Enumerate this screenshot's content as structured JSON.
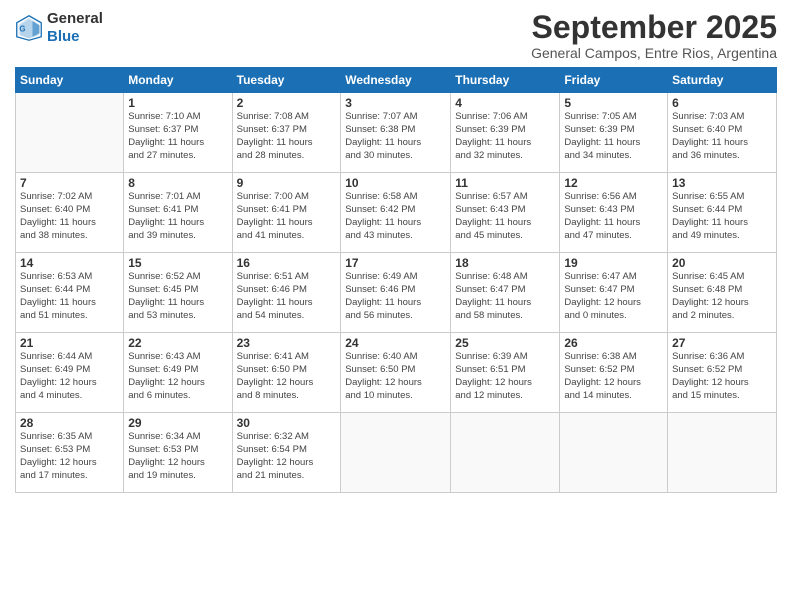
{
  "header": {
    "logo_general": "General",
    "logo_blue": "Blue",
    "title": "September 2025",
    "subtitle": "General Campos, Entre Rios, Argentina"
  },
  "days_of_week": [
    "Sunday",
    "Monday",
    "Tuesday",
    "Wednesday",
    "Thursday",
    "Friday",
    "Saturday"
  ],
  "weeks": [
    [
      {
        "day": "",
        "info": ""
      },
      {
        "day": "1",
        "info": "Sunrise: 7:10 AM\nSunset: 6:37 PM\nDaylight: 11 hours\nand 27 minutes."
      },
      {
        "day": "2",
        "info": "Sunrise: 7:08 AM\nSunset: 6:37 PM\nDaylight: 11 hours\nand 28 minutes."
      },
      {
        "day": "3",
        "info": "Sunrise: 7:07 AM\nSunset: 6:38 PM\nDaylight: 11 hours\nand 30 minutes."
      },
      {
        "day": "4",
        "info": "Sunrise: 7:06 AM\nSunset: 6:39 PM\nDaylight: 11 hours\nand 32 minutes."
      },
      {
        "day": "5",
        "info": "Sunrise: 7:05 AM\nSunset: 6:39 PM\nDaylight: 11 hours\nand 34 minutes."
      },
      {
        "day": "6",
        "info": "Sunrise: 7:03 AM\nSunset: 6:40 PM\nDaylight: 11 hours\nand 36 minutes."
      }
    ],
    [
      {
        "day": "7",
        "info": "Sunrise: 7:02 AM\nSunset: 6:40 PM\nDaylight: 11 hours\nand 38 minutes."
      },
      {
        "day": "8",
        "info": "Sunrise: 7:01 AM\nSunset: 6:41 PM\nDaylight: 11 hours\nand 39 minutes."
      },
      {
        "day": "9",
        "info": "Sunrise: 7:00 AM\nSunset: 6:41 PM\nDaylight: 11 hours\nand 41 minutes."
      },
      {
        "day": "10",
        "info": "Sunrise: 6:58 AM\nSunset: 6:42 PM\nDaylight: 11 hours\nand 43 minutes."
      },
      {
        "day": "11",
        "info": "Sunrise: 6:57 AM\nSunset: 6:43 PM\nDaylight: 11 hours\nand 45 minutes."
      },
      {
        "day": "12",
        "info": "Sunrise: 6:56 AM\nSunset: 6:43 PM\nDaylight: 11 hours\nand 47 minutes."
      },
      {
        "day": "13",
        "info": "Sunrise: 6:55 AM\nSunset: 6:44 PM\nDaylight: 11 hours\nand 49 minutes."
      }
    ],
    [
      {
        "day": "14",
        "info": "Sunrise: 6:53 AM\nSunset: 6:44 PM\nDaylight: 11 hours\nand 51 minutes."
      },
      {
        "day": "15",
        "info": "Sunrise: 6:52 AM\nSunset: 6:45 PM\nDaylight: 11 hours\nand 53 minutes."
      },
      {
        "day": "16",
        "info": "Sunrise: 6:51 AM\nSunset: 6:46 PM\nDaylight: 11 hours\nand 54 minutes."
      },
      {
        "day": "17",
        "info": "Sunrise: 6:49 AM\nSunset: 6:46 PM\nDaylight: 11 hours\nand 56 minutes."
      },
      {
        "day": "18",
        "info": "Sunrise: 6:48 AM\nSunset: 6:47 PM\nDaylight: 11 hours\nand 58 minutes."
      },
      {
        "day": "19",
        "info": "Sunrise: 6:47 AM\nSunset: 6:47 PM\nDaylight: 12 hours\nand 0 minutes."
      },
      {
        "day": "20",
        "info": "Sunrise: 6:45 AM\nSunset: 6:48 PM\nDaylight: 12 hours\nand 2 minutes."
      }
    ],
    [
      {
        "day": "21",
        "info": "Sunrise: 6:44 AM\nSunset: 6:49 PM\nDaylight: 12 hours\nand 4 minutes."
      },
      {
        "day": "22",
        "info": "Sunrise: 6:43 AM\nSunset: 6:49 PM\nDaylight: 12 hours\nand 6 minutes."
      },
      {
        "day": "23",
        "info": "Sunrise: 6:41 AM\nSunset: 6:50 PM\nDaylight: 12 hours\nand 8 minutes."
      },
      {
        "day": "24",
        "info": "Sunrise: 6:40 AM\nSunset: 6:50 PM\nDaylight: 12 hours\nand 10 minutes."
      },
      {
        "day": "25",
        "info": "Sunrise: 6:39 AM\nSunset: 6:51 PM\nDaylight: 12 hours\nand 12 minutes."
      },
      {
        "day": "26",
        "info": "Sunrise: 6:38 AM\nSunset: 6:52 PM\nDaylight: 12 hours\nand 14 minutes."
      },
      {
        "day": "27",
        "info": "Sunrise: 6:36 AM\nSunset: 6:52 PM\nDaylight: 12 hours\nand 15 minutes."
      }
    ],
    [
      {
        "day": "28",
        "info": "Sunrise: 6:35 AM\nSunset: 6:53 PM\nDaylight: 12 hours\nand 17 minutes."
      },
      {
        "day": "29",
        "info": "Sunrise: 6:34 AM\nSunset: 6:53 PM\nDaylight: 12 hours\nand 19 minutes."
      },
      {
        "day": "30",
        "info": "Sunrise: 6:32 AM\nSunset: 6:54 PM\nDaylight: 12 hours\nand 21 minutes."
      },
      {
        "day": "",
        "info": ""
      },
      {
        "day": "",
        "info": ""
      },
      {
        "day": "",
        "info": ""
      },
      {
        "day": "",
        "info": ""
      }
    ]
  ]
}
